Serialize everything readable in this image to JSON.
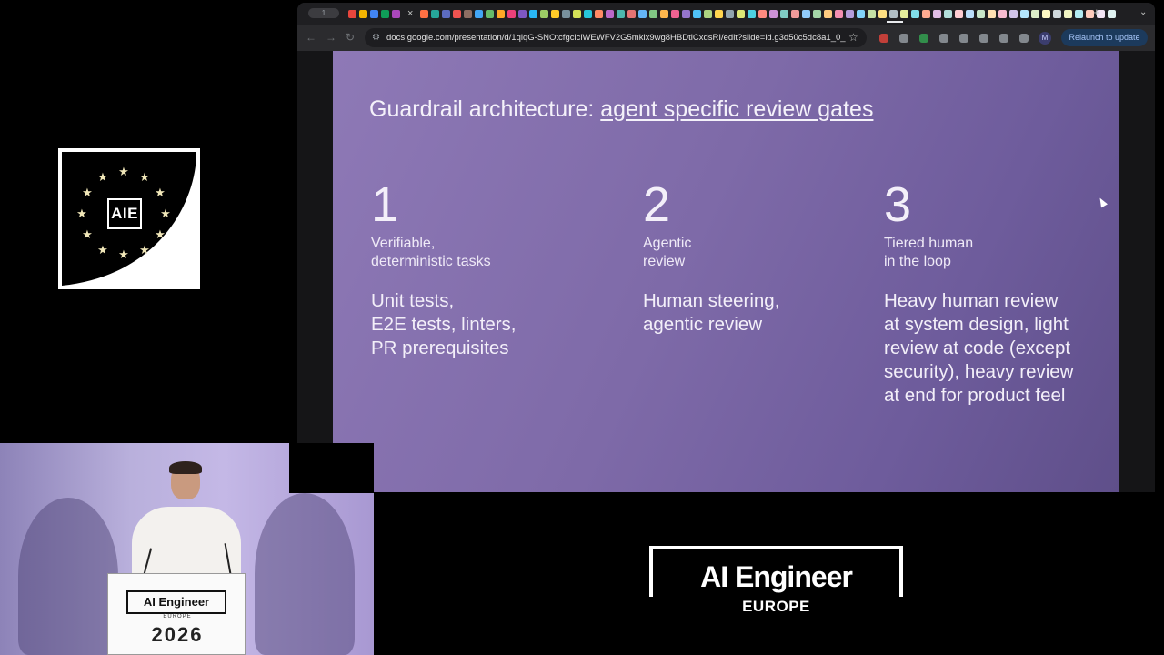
{
  "event_logo": {
    "text": "AIE"
  },
  "browser": {
    "tab_pill_label": "1",
    "tab_close": "×",
    "new_tab": "+",
    "tab_menu": "⌄",
    "favicon_colors": [
      "#e8453c",
      "#f4b400",
      "#4285f4",
      "#0f9d58",
      "#ab47bc",
      "#ff7043",
      "#26a69a",
      "#5c6bc0",
      "#ef5350",
      "#8d6e63",
      "#42a5f5",
      "#66bb6a",
      "#ffa726",
      "#ec407a",
      "#7e57c2",
      "#29b6f6",
      "#9ccc65",
      "#ffca28",
      "#78909c",
      "#d4e157",
      "#26c6da",
      "#ff8a65",
      "#ba68c8",
      "#4db6ac",
      "#e57373",
      "#64b5f6",
      "#81c784",
      "#ffb74d",
      "#f06292",
      "#9575cd",
      "#4fc3f7",
      "#aed581",
      "#ffd54f",
      "#90a4ae",
      "#dce775",
      "#4dd0e1",
      "#ff8a80",
      "#ce93d8",
      "#80cbc4",
      "#ef9a9a",
      "#90caf9",
      "#a5d6a7",
      "#ffcc80",
      "#f48fb1",
      "#b39ddb",
      "#81d4fa",
      "#c5e1a5",
      "#ffe082",
      "#b0bec5",
      "#e6ee9c",
      "#80deea",
      "#ffab91",
      "#e1bee7",
      "#b2dfdb",
      "#ffcdd2",
      "#bbdefb",
      "#c8e6c9",
      "#ffe0b2",
      "#f8bbd0",
      "#d1c4e9",
      "#b3e5fc",
      "#dcedc8",
      "#fff9c4",
      "#cfd8dc",
      "#f0f4c3",
      "#b2ebf2",
      "#ffccbc",
      "#f3e5f5",
      "#e0f2f1"
    ],
    "url": "docs.google.com/presentation/d/1qlqG-SNOtcfgclclWEWFV2G5mklx9wg8HBDtlCxdsRI/edit?slide=id.g3d50c5dc8a1_0_...",
    "profile_initial": "M",
    "relaunch_label": "Relaunch to update",
    "extension_colors": [
      "#e8453c",
      "#9aa0a6",
      "#34a853",
      "#9aa0a6",
      "#9aa0a6",
      "#9aa0a6",
      "#9aa0a6",
      "#9aa0a6"
    ]
  },
  "slide": {
    "title_prefix": "Guardrail architecture: ",
    "title_link": "agent specific review gates",
    "columns": [
      {
        "number": "1",
        "label": "Verifiable,\ndeterministic tasks",
        "body": "Unit tests,\nE2E tests, linters,\nPR prerequisites"
      },
      {
        "number": "2",
        "label": "Agentic\nreview",
        "body": "Human steering,\nagentic review"
      },
      {
        "number": "3",
        "label": "Tiered human\nin the loop",
        "body": "Heavy human review\nat system design, light\nreview at code (except\nsecurity), heavy review\nat end for product feel"
      }
    ]
  },
  "video": {
    "podium_logo": "AI Engineer",
    "podium_sub": "EUROPE",
    "podium_year": "2026"
  },
  "brand": {
    "main": "AI Engineer",
    "sub": "EUROPE"
  }
}
